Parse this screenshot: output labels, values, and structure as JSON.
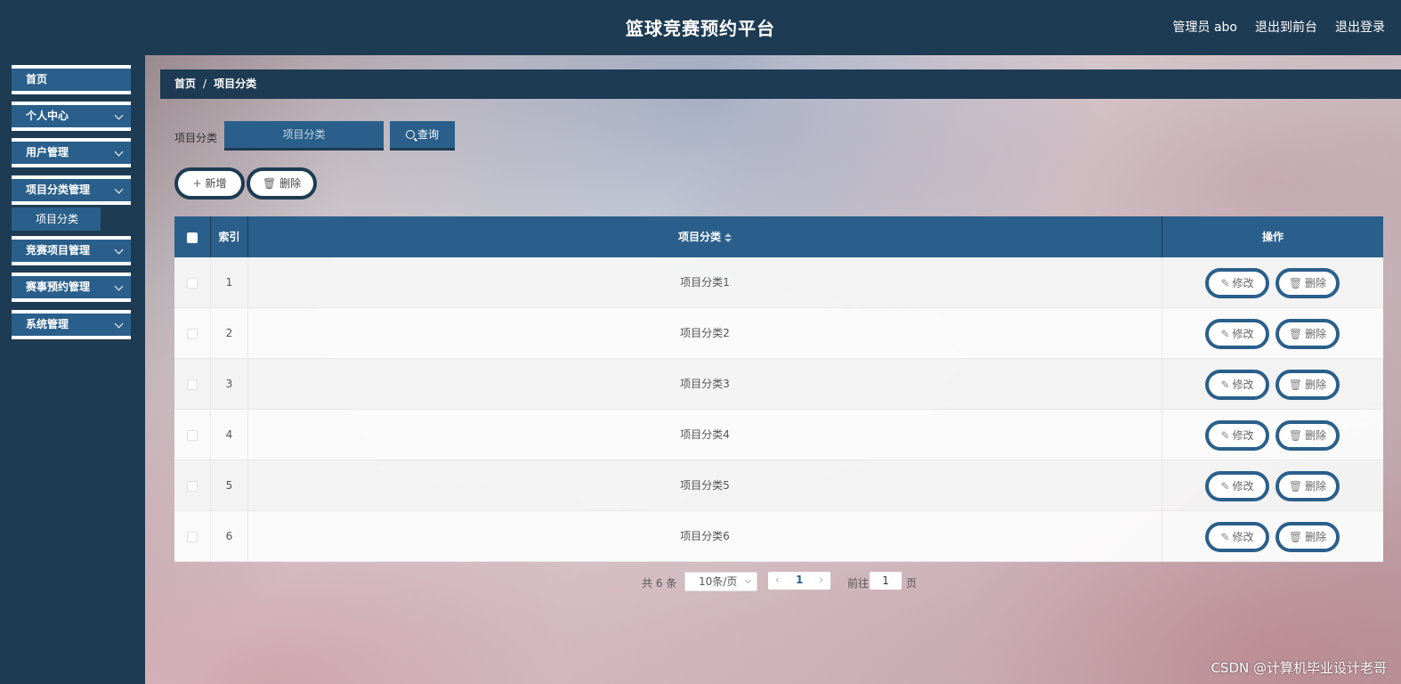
{
  "header": {
    "title": "篮球竞赛预约平台",
    "admin_label": "管理员 abo",
    "front_label": "退出到前台",
    "logout_label": "退出登录"
  },
  "sidebar": {
    "items": [
      {
        "label": "首页"
      },
      {
        "label": "个人中心"
      },
      {
        "label": "用户管理"
      },
      {
        "label": "项目分类管理"
      },
      {
        "label": "竞赛项目管理"
      },
      {
        "label": "赛事预约管理"
      },
      {
        "label": "系统管理"
      }
    ],
    "sub_item": "项目分类"
  },
  "breadcrumb": {
    "home": "首页",
    "separator": "/",
    "current": "项目分类"
  },
  "search": {
    "label": "项目分类",
    "placeholder": "项目分类",
    "button": "查询"
  },
  "actions": {
    "add": "新增",
    "delete": "删除"
  },
  "table": {
    "headers": {
      "index": "索引",
      "category": "项目分类",
      "ops": "操作"
    },
    "rows": [
      {
        "index": "1",
        "category": "项目分类1"
      },
      {
        "index": "2",
        "category": "项目分类2"
      },
      {
        "index": "3",
        "category": "项目分类3"
      },
      {
        "index": "4",
        "category": "项目分类4"
      },
      {
        "index": "5",
        "category": "项目分类5"
      },
      {
        "index": "6",
        "category": "项目分类6"
      }
    ],
    "edit_label": "修改",
    "delete_label": "删除"
  },
  "pagination": {
    "total": "共 6 条",
    "page_size": "10条/页",
    "current_page": "1",
    "goto_label": "前往",
    "goto_value": "1",
    "page_suffix": "页"
  },
  "watermark": "CSDN @计算机毕业设计老哥",
  "colors": {
    "header_bg": "#1d3b53",
    "accent": "#2a5f8b"
  }
}
